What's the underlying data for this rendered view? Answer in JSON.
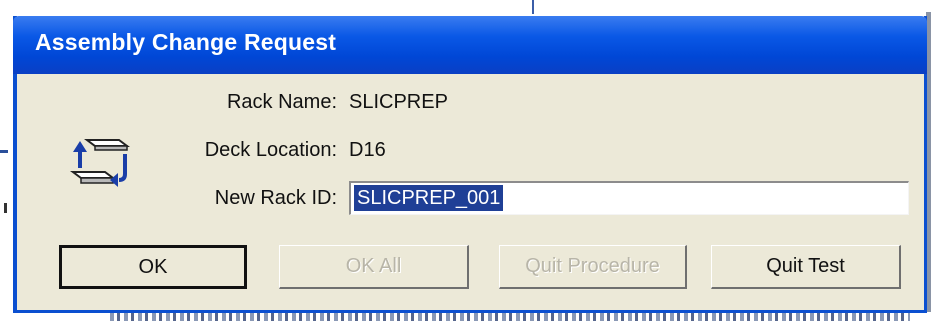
{
  "dialog": {
    "title": "Assembly Change Request",
    "icon": "rack-swap-icon"
  },
  "fields": {
    "rack_name_label": "Rack Name:",
    "rack_name_value": "SLICPREP",
    "deck_location_label": "Deck Location:",
    "deck_location_value": "D16",
    "new_rack_id_label": "New Rack ID:",
    "new_rack_id_value": "SLICPREP_001"
  },
  "buttons": {
    "ok": "OK",
    "ok_all": "OK All",
    "quit_procedure": "Quit Procedure",
    "quit_test": "Quit Test"
  },
  "colors": {
    "titlebar": "#0047d6",
    "dialog_bg": "#ece9d8",
    "selection": "#1f3f96"
  }
}
